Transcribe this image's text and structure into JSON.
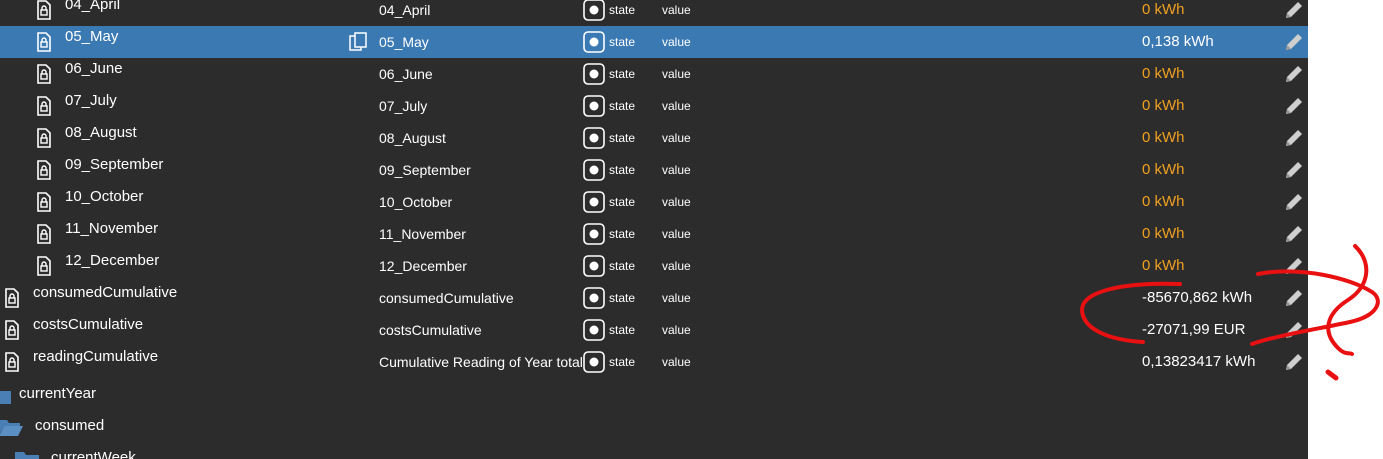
{
  "rows": [
    {
      "name": "04_April",
      "col_name": "04_April",
      "role": "state",
      "type": "value",
      "value": "0 kWh",
      "value_color": "orange"
    },
    {
      "name": "05_May",
      "col_name": "05_May",
      "role": "state",
      "type": "value",
      "value": "0,138 kWh",
      "value_color": "white"
    },
    {
      "name": "06_June",
      "col_name": "06_June",
      "role": "state",
      "type": "value",
      "value": "0 kWh",
      "value_color": "orange"
    },
    {
      "name": "07_July",
      "col_name": "07_July",
      "role": "state",
      "type": "value",
      "value": "0 kWh",
      "value_color": "orange"
    },
    {
      "name": "08_August",
      "col_name": "08_August",
      "role": "state",
      "type": "value",
      "value": "0 kWh",
      "value_color": "orange"
    },
    {
      "name": "09_September",
      "col_name": "09_September",
      "role": "state",
      "type": "value",
      "value": "0 kWh",
      "value_color": "orange"
    },
    {
      "name": "10_October",
      "col_name": "10_October",
      "role": "state",
      "type": "value",
      "value": "0 kWh",
      "value_color": "orange"
    },
    {
      "name": "11_November",
      "col_name": "11_November",
      "role": "state",
      "type": "value",
      "value": "0 kWh",
      "value_color": "orange"
    },
    {
      "name": "12_December",
      "col_name": "12_December",
      "role": "state",
      "type": "value",
      "value": "0 kWh",
      "value_color": "orange"
    },
    {
      "name": "consumedCumulative",
      "col_name": "consumedCumulative",
      "role": "state",
      "type": "value",
      "value": "-85670,862 kWh",
      "value_color": "white"
    },
    {
      "name": "costsCumulative",
      "col_name": "costsCumulative",
      "role": "state",
      "type": "value",
      "value": "-27071,99 EUR",
      "value_color": "white"
    },
    {
      "name": "readingCumulative",
      "col_name": "Cumulative Reading of Year total",
      "role": "state",
      "type": "value",
      "value": "0,13823417 kWh",
      "value_color": "white"
    }
  ],
  "folders": [
    {
      "label": "currentYear"
    },
    {
      "label": "consumed"
    },
    {
      "label": "currentWeek"
    }
  ],
  "colors": {
    "panel_bg": "#2c2c2c",
    "selected_row": "#3b79b3",
    "value_orange": "#f0a020",
    "folder_blue": "#4a7fb5",
    "annotation_red": "#e81010"
  },
  "icons": {
    "state_file": "file-lock-icon",
    "copy": "copy-icon",
    "role": "state-role-icon",
    "edit": "pencil-icon",
    "folder": "folder-icon"
  }
}
